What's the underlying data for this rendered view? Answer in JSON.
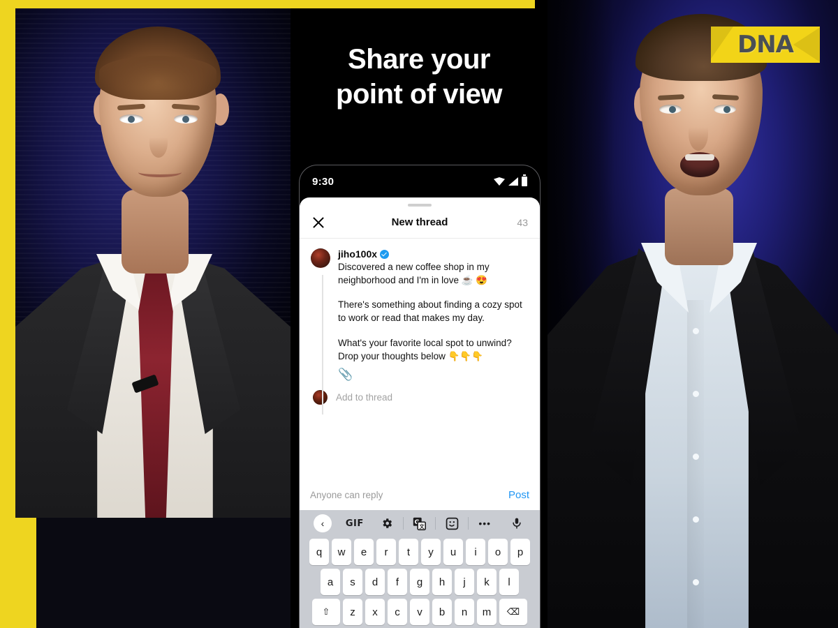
{
  "brand": {
    "logo_text": "DNA",
    "logo_bg": "#f2d418",
    "logo_fg": "#4a4f55",
    "frame_accent": "#eed520"
  },
  "promo": {
    "headline_line1": "Share your",
    "headline_line2": "point of view"
  },
  "photos": {
    "left": {
      "name": "mark-zuckerberg",
      "alt": "Man in dark suit with white shirt and dark red tie"
    },
    "right": {
      "name": "elon-musk",
      "alt": "Man in dark suit with light blue open-collar shirt"
    }
  },
  "phone": {
    "status_bar": {
      "time": "9:30",
      "icons": [
        "wifi-icon",
        "signal-icon",
        "battery-icon"
      ]
    },
    "sheet": {
      "close_label": "✕",
      "title": "New thread",
      "char_count": "43"
    },
    "compose": {
      "handle": "jiho100x",
      "verified": true,
      "paragraph1": "Discovered a new coffee shop in my neighborhood and I'm in love ☕ 😍",
      "paragraph2": "There's something about finding a cozy spot to work or read that makes my day.",
      "paragraph3": "What's your favorite local spot to unwind?Drop your thoughts below 👇👇👇",
      "attach_icon": "📎",
      "add_to_thread_placeholder": "Add to thread"
    },
    "reply_bar": {
      "audience": "Anyone can reply",
      "post_label": "Post",
      "post_color": "#2196f3"
    },
    "keyboard": {
      "toolbar": [
        {
          "name": "keyboard-back-button",
          "label": "‹"
        },
        {
          "name": "gif-button",
          "label": "GIF"
        },
        {
          "name": "settings-gear-icon",
          "label": ""
        },
        {
          "name": "translate-icon",
          "label": ""
        },
        {
          "name": "sticker-icon",
          "label": ""
        },
        {
          "name": "more-options-icon",
          "label": "•••"
        },
        {
          "name": "microphone-icon",
          "label": ""
        }
      ],
      "row1": [
        "q",
        "w",
        "e",
        "r",
        "t",
        "y",
        "u",
        "i",
        "o",
        "p"
      ],
      "row2": [
        "a",
        "s",
        "d",
        "f",
        "g",
        "h",
        "j",
        "k",
        "l"
      ],
      "row3": [
        "⇧",
        "z",
        "x",
        "c",
        "v",
        "b",
        "n",
        "m",
        "⌫"
      ]
    }
  }
}
